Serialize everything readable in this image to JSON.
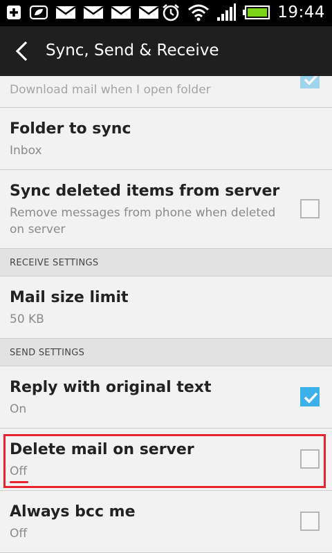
{
  "status_bar": {
    "time": "19:44",
    "icons": [
      "add-icon",
      "leaf-icon",
      "mail-icon",
      "mail-icon",
      "mail-icon",
      "mail-icon",
      "alarm-icon",
      "wifi-icon",
      "signal-icon",
      "battery-icon"
    ]
  },
  "header": {
    "title": "Sync, Send & Receive"
  },
  "items": {
    "top_partial": {
      "subtitle": "Download mail when I open folder",
      "checked": true
    },
    "folder_to_sync": {
      "title": "Folder to sync",
      "subtitle": "Inbox"
    },
    "sync_deleted": {
      "title": "Sync deleted items from server",
      "subtitle": "Remove messages from phone when deleted on server",
      "checked": false
    },
    "receive_section": "RECEIVE SETTINGS",
    "mail_size": {
      "title": "Mail size limit",
      "subtitle": "50 KB"
    },
    "send_section": "SEND SETTINGS",
    "reply_original": {
      "title": "Reply with original text",
      "subtitle": "On",
      "checked": true
    },
    "delete_on_server": {
      "title": "Delete mail on server",
      "subtitle": "Off",
      "checked": false
    },
    "always_bcc": {
      "title": "Always bcc me",
      "subtitle": "Off",
      "checked": false
    }
  },
  "colors": {
    "accent": "#3cb0e8",
    "highlight": "#e8232f"
  }
}
